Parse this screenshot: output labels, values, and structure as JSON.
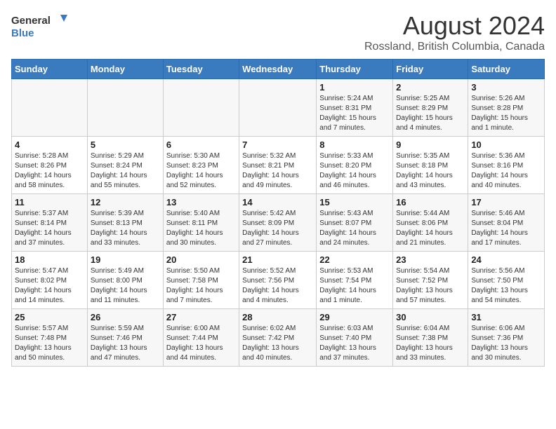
{
  "logo": {
    "line1": "General",
    "line2": "Blue"
  },
  "title": "August 2024",
  "subtitle": "Rossland, British Columbia, Canada",
  "weekdays": [
    "Sunday",
    "Monday",
    "Tuesday",
    "Wednesday",
    "Thursday",
    "Friday",
    "Saturday"
  ],
  "weeks": [
    [
      {
        "day": "",
        "info": ""
      },
      {
        "day": "",
        "info": ""
      },
      {
        "day": "",
        "info": ""
      },
      {
        "day": "",
        "info": ""
      },
      {
        "day": "1",
        "info": "Sunrise: 5:24 AM\nSunset: 8:31 PM\nDaylight: 15 hours\nand 7 minutes."
      },
      {
        "day": "2",
        "info": "Sunrise: 5:25 AM\nSunset: 8:29 PM\nDaylight: 15 hours\nand 4 minutes."
      },
      {
        "day": "3",
        "info": "Sunrise: 5:26 AM\nSunset: 8:28 PM\nDaylight: 15 hours\nand 1 minute."
      }
    ],
    [
      {
        "day": "4",
        "info": "Sunrise: 5:28 AM\nSunset: 8:26 PM\nDaylight: 14 hours\nand 58 minutes."
      },
      {
        "day": "5",
        "info": "Sunrise: 5:29 AM\nSunset: 8:24 PM\nDaylight: 14 hours\nand 55 minutes."
      },
      {
        "day": "6",
        "info": "Sunrise: 5:30 AM\nSunset: 8:23 PM\nDaylight: 14 hours\nand 52 minutes."
      },
      {
        "day": "7",
        "info": "Sunrise: 5:32 AM\nSunset: 8:21 PM\nDaylight: 14 hours\nand 49 minutes."
      },
      {
        "day": "8",
        "info": "Sunrise: 5:33 AM\nSunset: 8:20 PM\nDaylight: 14 hours\nand 46 minutes."
      },
      {
        "day": "9",
        "info": "Sunrise: 5:35 AM\nSunset: 8:18 PM\nDaylight: 14 hours\nand 43 minutes."
      },
      {
        "day": "10",
        "info": "Sunrise: 5:36 AM\nSunset: 8:16 PM\nDaylight: 14 hours\nand 40 minutes."
      }
    ],
    [
      {
        "day": "11",
        "info": "Sunrise: 5:37 AM\nSunset: 8:14 PM\nDaylight: 14 hours\nand 37 minutes."
      },
      {
        "day": "12",
        "info": "Sunrise: 5:39 AM\nSunset: 8:13 PM\nDaylight: 14 hours\nand 33 minutes."
      },
      {
        "day": "13",
        "info": "Sunrise: 5:40 AM\nSunset: 8:11 PM\nDaylight: 14 hours\nand 30 minutes."
      },
      {
        "day": "14",
        "info": "Sunrise: 5:42 AM\nSunset: 8:09 PM\nDaylight: 14 hours\nand 27 minutes."
      },
      {
        "day": "15",
        "info": "Sunrise: 5:43 AM\nSunset: 8:07 PM\nDaylight: 14 hours\nand 24 minutes."
      },
      {
        "day": "16",
        "info": "Sunrise: 5:44 AM\nSunset: 8:06 PM\nDaylight: 14 hours\nand 21 minutes."
      },
      {
        "day": "17",
        "info": "Sunrise: 5:46 AM\nSunset: 8:04 PM\nDaylight: 14 hours\nand 17 minutes."
      }
    ],
    [
      {
        "day": "18",
        "info": "Sunrise: 5:47 AM\nSunset: 8:02 PM\nDaylight: 14 hours\nand 14 minutes."
      },
      {
        "day": "19",
        "info": "Sunrise: 5:49 AM\nSunset: 8:00 PM\nDaylight: 14 hours\nand 11 minutes."
      },
      {
        "day": "20",
        "info": "Sunrise: 5:50 AM\nSunset: 7:58 PM\nDaylight: 14 hours\nand 7 minutes."
      },
      {
        "day": "21",
        "info": "Sunrise: 5:52 AM\nSunset: 7:56 PM\nDaylight: 14 hours\nand 4 minutes."
      },
      {
        "day": "22",
        "info": "Sunrise: 5:53 AM\nSunset: 7:54 PM\nDaylight: 14 hours\nand 1 minute."
      },
      {
        "day": "23",
        "info": "Sunrise: 5:54 AM\nSunset: 7:52 PM\nDaylight: 13 hours\nand 57 minutes."
      },
      {
        "day": "24",
        "info": "Sunrise: 5:56 AM\nSunset: 7:50 PM\nDaylight: 13 hours\nand 54 minutes."
      }
    ],
    [
      {
        "day": "25",
        "info": "Sunrise: 5:57 AM\nSunset: 7:48 PM\nDaylight: 13 hours\nand 50 minutes."
      },
      {
        "day": "26",
        "info": "Sunrise: 5:59 AM\nSunset: 7:46 PM\nDaylight: 13 hours\nand 47 minutes."
      },
      {
        "day": "27",
        "info": "Sunrise: 6:00 AM\nSunset: 7:44 PM\nDaylight: 13 hours\nand 44 minutes."
      },
      {
        "day": "28",
        "info": "Sunrise: 6:02 AM\nSunset: 7:42 PM\nDaylight: 13 hours\nand 40 minutes."
      },
      {
        "day": "29",
        "info": "Sunrise: 6:03 AM\nSunset: 7:40 PM\nDaylight: 13 hours\nand 37 minutes."
      },
      {
        "day": "30",
        "info": "Sunrise: 6:04 AM\nSunset: 7:38 PM\nDaylight: 13 hours\nand 33 minutes."
      },
      {
        "day": "31",
        "info": "Sunrise: 6:06 AM\nSunset: 7:36 PM\nDaylight: 13 hours\nand 30 minutes."
      }
    ]
  ]
}
